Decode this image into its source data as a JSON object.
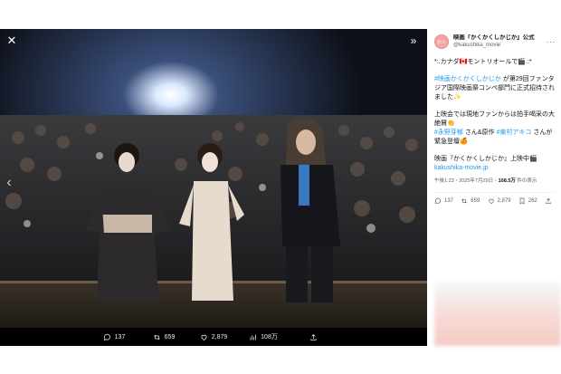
{
  "viewer": {
    "close_icon": "close-icon",
    "expand_icon": "expand-icon",
    "prev_icon": "chevron-left-icon",
    "actions": {
      "replies": "137",
      "reposts": "659",
      "likes": "2,879",
      "views": "108万"
    }
  },
  "tweet": {
    "author": {
      "display_name": "映画『かくかくしかじか』公式",
      "handle": "@kakushika_movie"
    },
    "line1": "*:.カナダ🇨🇦モントリオールで🎬.:*",
    "hashtag1": "#映画かくかくしかじか",
    "para2_rest": " が第29回ファンタジア国際映画祭コンペ部門に正式招待されました✨",
    "para3_a": "上映会では現地ファンからは拍手喝采の大絶賛👏",
    "hashtag2": "#永野芽郁",
    "para3_b": " さん&原作 ",
    "hashtag3": "#東村アキコ",
    "para3_c": " さんが緊急登壇🍊",
    "para4_a": "映画『かくかくしかじか』上映中🎬",
    "link": "kakushika-movie.jp",
    "meta_time": "午後1:23・2025年7月29日・",
    "meta_views": "108.5万",
    "meta_suffix": " 件の表示",
    "stats": {
      "replies": "137",
      "reposts": "659",
      "likes": "2,879",
      "bookmarks": "262"
    }
  },
  "colors": {
    "link": "#1d9bf0",
    "text": "#0f1419",
    "muted": "#536471"
  }
}
